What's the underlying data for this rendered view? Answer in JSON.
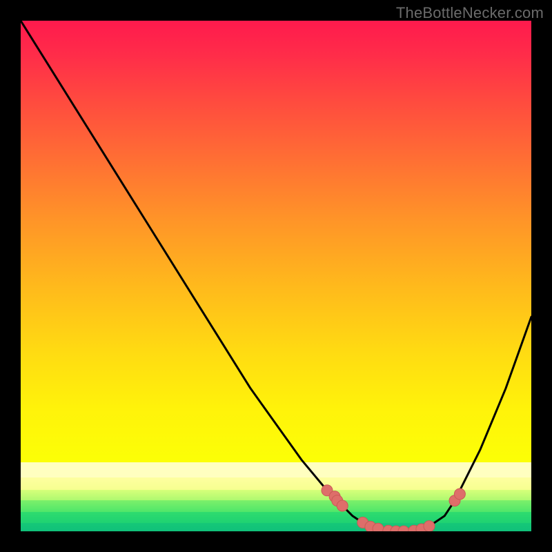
{
  "attribution": "TheBottleNecker.com",
  "chart_data": {
    "type": "line",
    "title": "",
    "xlabel": "",
    "ylabel": "",
    "xlim": [
      0,
      100
    ],
    "ylim": [
      0,
      100
    ],
    "series": [
      {
        "name": "bottleneck-curve",
        "x": [
          0,
          5,
          10,
          15,
          20,
          25,
          30,
          35,
          40,
          45,
          50,
          55,
          60,
          62,
          65,
          68,
          70,
          73,
          75,
          78,
          80,
          83,
          85,
          90,
          95,
          100
        ],
        "y": [
          100,
          92,
          84,
          76,
          68,
          60,
          52,
          44,
          36,
          28,
          21,
          14,
          8,
          6,
          3,
          1,
          0.5,
          0,
          0,
          0,
          1,
          3,
          6,
          16,
          28,
          42
        ]
      }
    ],
    "markers": {
      "name": "data-points",
      "x": [
        60,
        61.5,
        62,
        63,
        67,
        68.5,
        70,
        72,
        73.5,
        75,
        77,
        78.5,
        80,
        85,
        86
      ],
      "y": [
        8,
        6.8,
        6,
        5,
        1.7,
        0.9,
        0.5,
        0.1,
        0,
        0,
        0.1,
        0.4,
        1,
        6,
        7.3
      ]
    },
    "colors": {
      "curve": "#000000",
      "marker_fill": "#de6e6a",
      "marker_stroke": "#c95a56"
    }
  }
}
